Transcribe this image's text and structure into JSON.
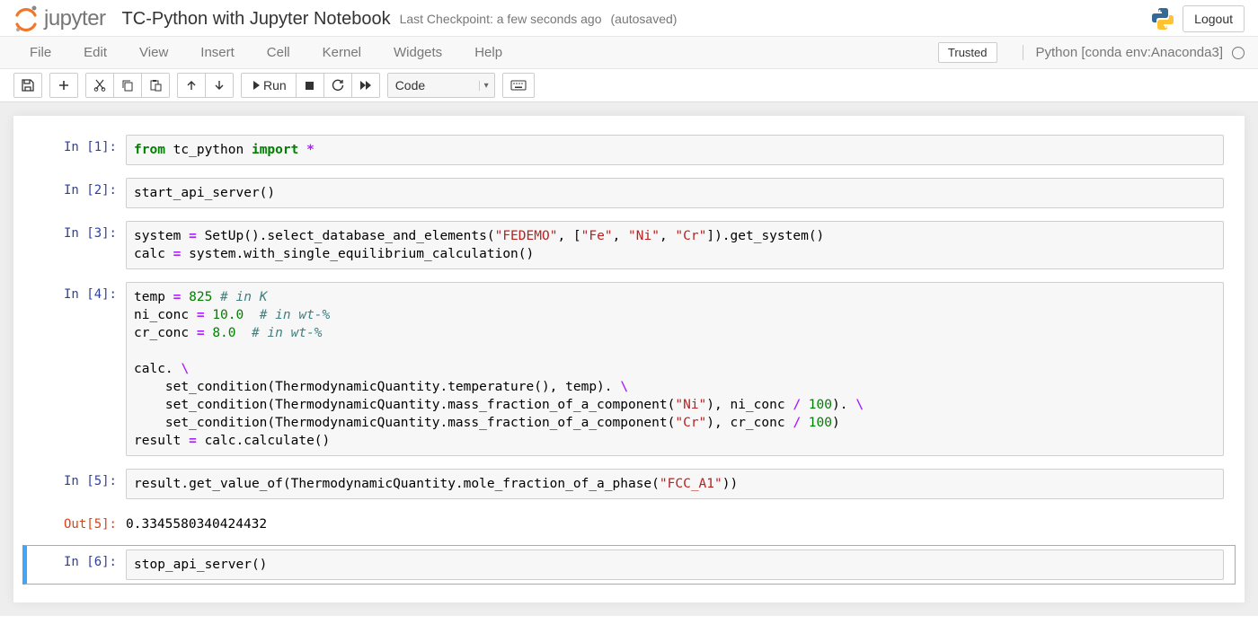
{
  "header": {
    "logo_text": "jupyter",
    "title": "TC-Python with Jupyter Notebook",
    "checkpoint": "Last Checkpoint: a few seconds ago",
    "autosave": "(autosaved)",
    "logout": "Logout"
  },
  "menu": {
    "items": [
      "File",
      "Edit",
      "View",
      "Insert",
      "Cell",
      "Kernel",
      "Widgets",
      "Help"
    ],
    "trusted": "Trusted",
    "kernel": "Python [conda env:Anaconda3]"
  },
  "toolbar": {
    "run_label": "Run",
    "cell_type": "Code"
  },
  "cells": [
    {
      "in": "In [1]:",
      "tokens": [
        {
          "t": "from ",
          "c": "cm-kw"
        },
        {
          "t": "tc_python ",
          "c": ""
        },
        {
          "t": "import ",
          "c": "cm-kw"
        },
        {
          "t": "*",
          "c": "cm-op"
        }
      ]
    },
    {
      "in": "In [2]:",
      "tokens": [
        {
          "t": "start_api_server()",
          "c": ""
        }
      ]
    },
    {
      "in": "In [3]:",
      "tokens": [
        {
          "t": "system ",
          "c": ""
        },
        {
          "t": "= ",
          "c": "cm-op"
        },
        {
          "t": "SetUp().select_database_and_elements(",
          "c": ""
        },
        {
          "t": "\"FEDEMO\"",
          "c": "cm-str"
        },
        {
          "t": ", [",
          "c": ""
        },
        {
          "t": "\"Fe\"",
          "c": "cm-str"
        },
        {
          "t": ", ",
          "c": ""
        },
        {
          "t": "\"Ni\"",
          "c": "cm-str"
        },
        {
          "t": ", ",
          "c": ""
        },
        {
          "t": "\"Cr\"",
          "c": "cm-str"
        },
        {
          "t": "]).get_system()\n",
          "c": ""
        },
        {
          "t": "calc ",
          "c": ""
        },
        {
          "t": "= ",
          "c": "cm-op"
        },
        {
          "t": "system.with_single_equilibrium_calculation()",
          "c": ""
        }
      ]
    },
    {
      "in": "In [4]:",
      "tokens": [
        {
          "t": "temp ",
          "c": ""
        },
        {
          "t": "= ",
          "c": "cm-op"
        },
        {
          "t": "825 ",
          "c": "cm-num"
        },
        {
          "t": "# in K",
          "c": "cm-com"
        },
        {
          "t": "\n",
          "c": ""
        },
        {
          "t": "ni_conc ",
          "c": ""
        },
        {
          "t": "= ",
          "c": "cm-op"
        },
        {
          "t": "10.0  ",
          "c": "cm-num"
        },
        {
          "t": "# in wt-%",
          "c": "cm-com"
        },
        {
          "t": "\n",
          "c": ""
        },
        {
          "t": "cr_conc ",
          "c": ""
        },
        {
          "t": "= ",
          "c": "cm-op"
        },
        {
          "t": "8.0  ",
          "c": "cm-num"
        },
        {
          "t": "# in wt-%",
          "c": "cm-com"
        },
        {
          "t": "\n\n",
          "c": ""
        },
        {
          "t": "calc. ",
          "c": ""
        },
        {
          "t": "\\",
          "c": "cm-op"
        },
        {
          "t": "\n",
          "c": ""
        },
        {
          "t": "    set_condition(ThermodynamicQuantity.temperature(), temp). ",
          "c": ""
        },
        {
          "t": "\\",
          "c": "cm-op"
        },
        {
          "t": "\n",
          "c": ""
        },
        {
          "t": "    set_condition(ThermodynamicQuantity.mass_fraction_of_a_component(",
          "c": ""
        },
        {
          "t": "\"Ni\"",
          "c": "cm-str"
        },
        {
          "t": "), ni_conc ",
          "c": ""
        },
        {
          "t": "/ ",
          "c": "cm-op"
        },
        {
          "t": "100",
          "c": "cm-num"
        },
        {
          "t": "). ",
          "c": ""
        },
        {
          "t": "\\",
          "c": "cm-op"
        },
        {
          "t": "\n",
          "c": ""
        },
        {
          "t": "    set_condition(ThermodynamicQuantity.mass_fraction_of_a_component(",
          "c": ""
        },
        {
          "t": "\"Cr\"",
          "c": "cm-str"
        },
        {
          "t": "), cr_conc ",
          "c": ""
        },
        {
          "t": "/ ",
          "c": "cm-op"
        },
        {
          "t": "100",
          "c": "cm-num"
        },
        {
          "t": ")\n",
          "c": ""
        },
        {
          "t": "result ",
          "c": ""
        },
        {
          "t": "= ",
          "c": "cm-op"
        },
        {
          "t": "calc.calculate()",
          "c": ""
        }
      ]
    },
    {
      "in": "In [5]:",
      "tokens": [
        {
          "t": "result.get_value_of(ThermodynamicQuantity.mole_fraction_of_a_phase(",
          "c": ""
        },
        {
          "t": "\"FCC_A1\"",
          "c": "cm-str"
        },
        {
          "t": "))",
          "c": ""
        }
      ],
      "out_label": "Out[5]:",
      "out": "0.3345580340424432"
    },
    {
      "in": "In [6]:",
      "tokens": [
        {
          "t": "stop_api_server()",
          "c": ""
        }
      ],
      "selected": true
    }
  ]
}
